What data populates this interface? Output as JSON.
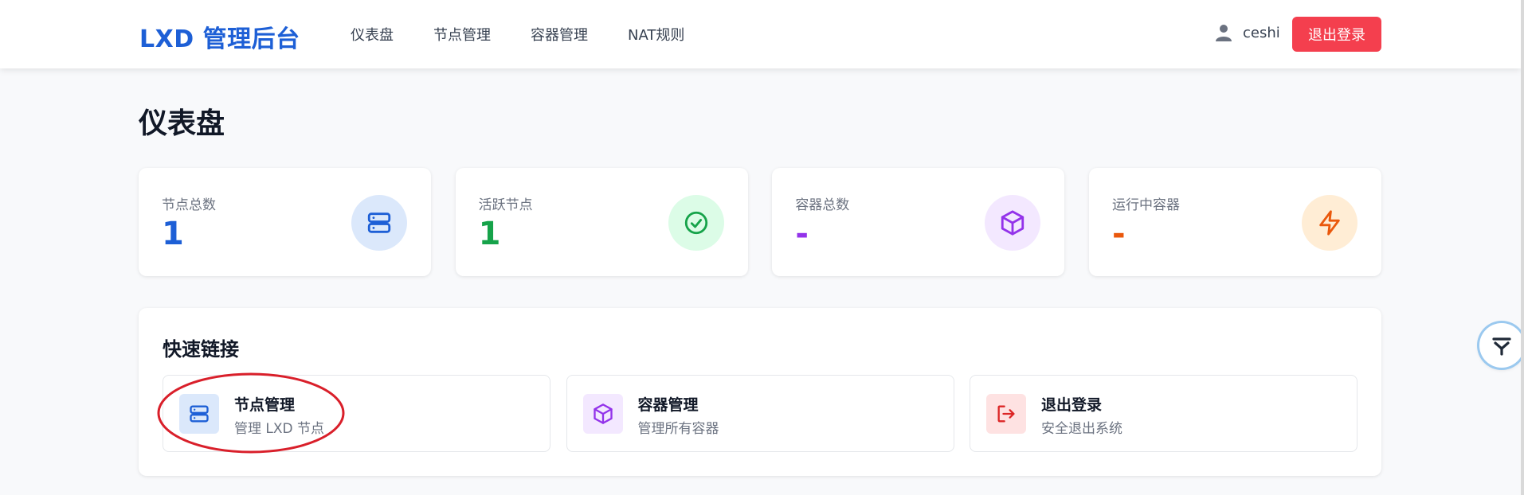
{
  "header": {
    "brand": "LXD 管理后台",
    "nav": [
      "仪表盘",
      "节点管理",
      "容器管理",
      "NAT规则"
    ],
    "username": "ceshi",
    "logout_label": "退出登录"
  },
  "page_title": "仪表盘",
  "stats": [
    {
      "label": "节点总数",
      "value": "1",
      "color": "#1d5fd6",
      "icon": "server-icon"
    },
    {
      "label": "活跃节点",
      "value": "1",
      "color": "#16a34a",
      "icon": "check-circle-icon"
    },
    {
      "label": "容器总数",
      "value": "-",
      "color": "#9333ea",
      "icon": "cube-icon"
    },
    {
      "label": "运行中容器",
      "value": "-",
      "color": "#ea580c",
      "icon": "bolt-icon"
    }
  ],
  "quick_links": {
    "title": "快速链接",
    "items": [
      {
        "title": "节点管理",
        "desc": "管理 LXD 节点",
        "icon": "server-icon"
      },
      {
        "title": "容器管理",
        "desc": "管理所有容器",
        "icon": "cube-icon"
      },
      {
        "title": "退出登录",
        "desc": "安全退出系统",
        "icon": "logout-icon"
      }
    ]
  },
  "colors": {
    "accent_blue": "#1d5fd6",
    "danger_red": "#f43f4e",
    "annotation_red": "#d91f2a"
  }
}
